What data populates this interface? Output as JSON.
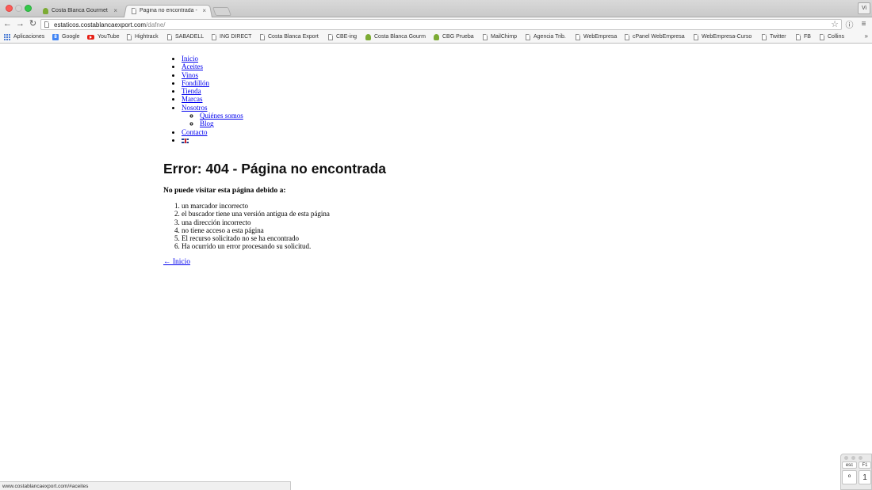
{
  "browser": {
    "tabs": [
      {
        "title": "Costa Blanca Gourmet",
        "close": "×",
        "active": false
      },
      {
        "title": "Pagina no encontrada - Co",
        "close": "×",
        "active": true
      }
    ],
    "profile_label": "Vi",
    "url_host": "estaticos.costablancaexport.com",
    "url_path": "/dafne/",
    "bookmarks": [
      "Aplicaciones",
      "Google",
      "YouTube",
      "Hightrack",
      "SABADELL",
      "ING DIRECT",
      "Costa Blanca Export",
      "CBE-ing",
      "Costa Blanca Gourm",
      "CBG Prueba",
      "MailChimp",
      "Agencia Trib.",
      "WebEmpresa",
      "cPanel WebEmpresa",
      "WebEmpresa-Curso",
      "Twitter",
      "FB",
      "Collins"
    ],
    "bookmarks_overflow": "»",
    "status_url": "www.costablancaexport.com/#aceites"
  },
  "nav": {
    "items": [
      "Inicio",
      "Aceites",
      "Vinos",
      "Fondillón",
      "Tienda",
      "Marcas",
      "Nosotros"
    ],
    "sub_items": [
      "Quiénes somos",
      "Blog"
    ],
    "contact": "Contacto"
  },
  "error": {
    "title": "Error: 404 - Página no encontrada",
    "subtitle": "No puede visitar esta página debido a:",
    "reasons": [
      "un marcador incorrecto",
      "el buscador tiene una versión antigua de esta página",
      "una dirección incorrecto",
      "no tiene acceso a esta página",
      "El recurso solicitado no se ha encontrado",
      "Ha ocurrido un error procesando su solicitud."
    ],
    "home_link": "← Inicio"
  },
  "keyboard": {
    "keys": [
      "esc",
      "F1",
      "º",
      "1"
    ]
  },
  "colors": {
    "link": "#0000ee",
    "favicon_leaf": "#7cab34",
    "close_button": "#fc5b57"
  }
}
